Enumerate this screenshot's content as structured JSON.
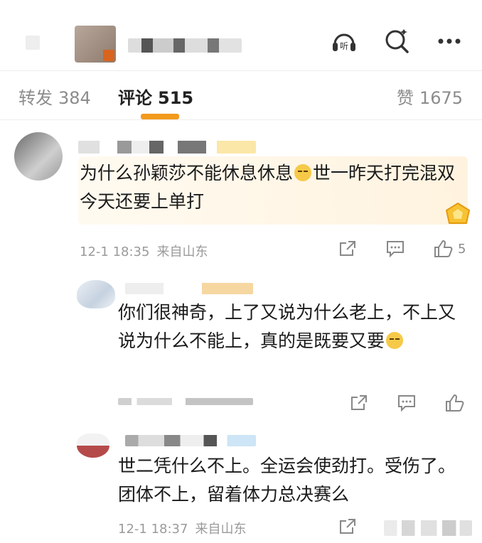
{
  "top_icons": [
    "listen-icon",
    "search-icon",
    "more-icon"
  ],
  "listen_label": "听",
  "tabs": {
    "repost_label": "转发",
    "repost_count": "384",
    "comment_label": "评论",
    "comment_count": "515",
    "like_label": "赞",
    "like_count": "1675"
  },
  "colors": {
    "accent": "#f39a1e",
    "meta": "#9a9a9a",
    "tab_inactive": "#8c8c8c"
  },
  "comments": [
    {
      "text_before": "为什么孙颖莎不能休息休息",
      "text_after": "世一昨天打完混双今天还要上单打",
      "time": "12-1 18:35",
      "source": "来自山东",
      "likes": "5"
    },
    {
      "text_before": "你们很神奇，上了又说为什么老上，不上又说为什么不能上，真的是既要又要",
      "text_after": "",
      "time": "",
      "source": "",
      "likes": ""
    },
    {
      "text_before": "世二凭什么不上。全运会使劲打。受伤了。团体不上，留着体力总决赛么",
      "text_after": "",
      "time": "12-1 18:37",
      "source": "来自山东",
      "likes": ""
    }
  ]
}
